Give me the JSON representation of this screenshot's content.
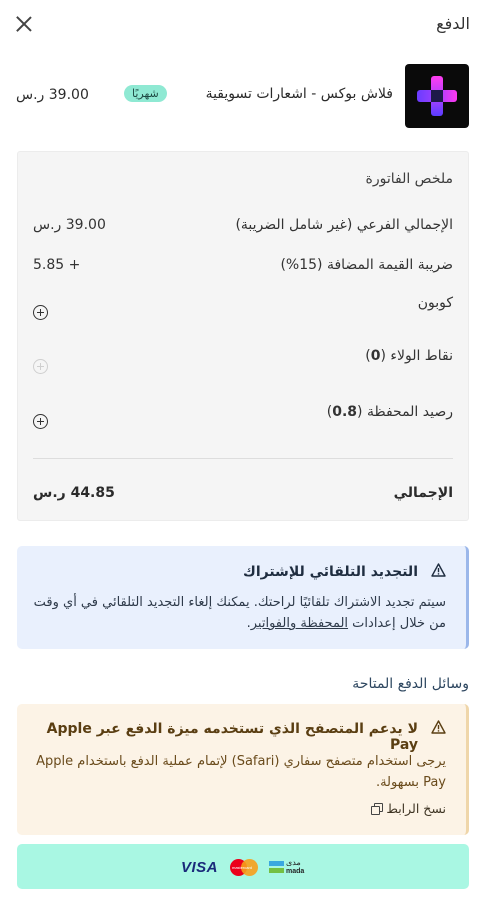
{
  "header": {
    "title": "الدفع",
    "close_icon": "close-icon"
  },
  "product": {
    "name": "فلاش بوكس - اشعارات تسويقية",
    "badge": "شهريًا",
    "price": "39.00 ر.س",
    "logo_icon": "flashbox-logo"
  },
  "invoice": {
    "title": "ملخص الفاتورة",
    "subtotal_label": "الإجمالي الفرعي (غير شامل الضريبة)",
    "subtotal_value": "39.00 ر.س",
    "vat_label": "ضريبة القيمة المضافة (15%)",
    "vat_value": "+ 5.85",
    "coupon_label": "كوبون",
    "loyalty_label_prefix": "نقاط الولاء (",
    "loyalty_value": "0",
    "loyalty_label_suffix": ")",
    "wallet_label_prefix": "رصيد المحفظة (",
    "wallet_value": "0.8",
    "wallet_label_suffix": ")",
    "total_label": "الإجمالي",
    "total_value": "44.85 ر.س"
  },
  "renew": {
    "title": "التجديد التلقائي للإشتراك",
    "body": "سيتم تجديد الاشتراك تلقائيًا لراحتك. يمكنك إلغاء التجديد التلقائي في أي وقت من خلال إعدادات ",
    "link": "المحفظة والفواتير",
    "body_end": "."
  },
  "methods": {
    "title": "وسائل الدفع المتاحة"
  },
  "apple_pay": {
    "title": "لا يدعم المتصفح الذي تستخدمه ميزة الدفع عبر Apple Pay",
    "body": "يرجى استخدام متصفح سفاري (Safari) لإتمام عملية الدفع باستخدام Apple Pay بسهولة.",
    "copy_link": "نسخ الرابط"
  },
  "pay_button": {
    "visa": "VISA",
    "mastercard": "mastercard",
    "mada_ar": "مدى",
    "mada_en": "mada"
  },
  "colors": {
    "accent": "#a9f7e3",
    "badge": "#8fe9d3",
    "info_bg": "#e9f0fd",
    "warning_bg": "#fcf3e6"
  }
}
